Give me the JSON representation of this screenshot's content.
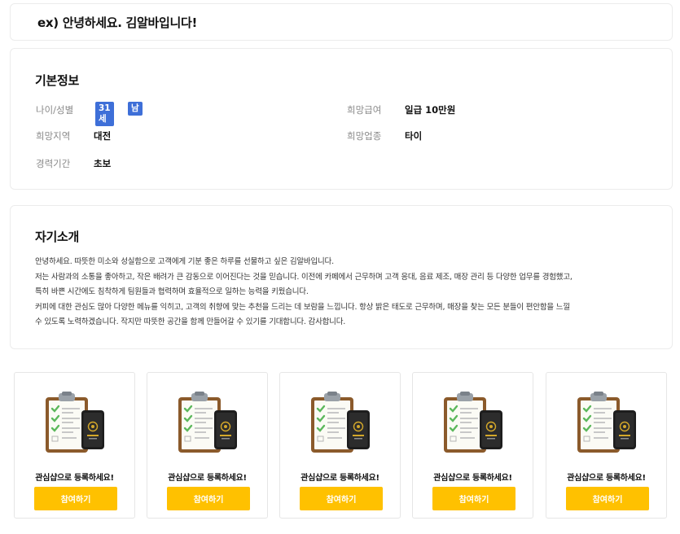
{
  "header": {
    "headline": "ex) 안녕하세요. 김알바입니다!"
  },
  "basic_info": {
    "title": "기본정보",
    "age_gender": {
      "label": "나이/성별",
      "age": "31세",
      "gender": "남"
    },
    "desired_pay": {
      "label": "희망급여",
      "value": "일급 10만원"
    },
    "desired_region": {
      "label": "희망지역",
      "value": "대전"
    },
    "desired_job": {
      "label": "희망업종",
      "value": "타이"
    },
    "experience": {
      "label": "경력기간",
      "value": "초보"
    }
  },
  "intro": {
    "title": "자기소개",
    "lines": [
      "안녕하세요. 따뜻한 미소와 성실함으로 고객에게 기분 좋은 하루를 선물하고 싶은 김알바입니다.",
      "저는 사람과의 소통을 좋아하고, 작은 배려가 큰 감동으로 이어진다는 것을 믿습니다. 이전에 카페에서 근무하며 고객 응대, 음료 제조, 매장 관리 등 다양한 업무를 경험했고,",
      "특히 바쁜 시간에도 침착하게 팀원들과 협력하며 효율적으로 일하는 능력을 키웠습니다.",
      "커피에 대한 관심도 많아 다양한 메뉴를 익히고, 고객의 취향에 맞는 추천을 드리는 데 보람을 느낍니다. 항상 밝은 태도로 근무하며, 매장을 찾는 모든 분들이 편안함을 느낄",
      "수 있도록 노력하겠습니다. 작지만 따뜻한 공간을 함께 만들어갈 수 있기를 기대합니다. 감사합니다."
    ]
  },
  "promos": [
    {
      "text": "관심샵으로 등록하세요!",
      "button": "참여하기"
    },
    {
      "text": "관심샵으로 등록하세요!",
      "button": "참여하기"
    },
    {
      "text": "관심샵으로 등록하세요!",
      "button": "참여하기"
    },
    {
      "text": "관심샵으로 등록하세요!",
      "button": "참여하기"
    },
    {
      "text": "관심샵으로 등록하세요!",
      "button": "참여하기"
    }
  ],
  "colors": {
    "badge": "#3e6fd8",
    "button": "#ffc100",
    "clipboard": "#8b5a2b",
    "check": "#5cb85c"
  },
  "icons": {
    "promo_illustration": "clipboard-checklist-phone-icon"
  }
}
